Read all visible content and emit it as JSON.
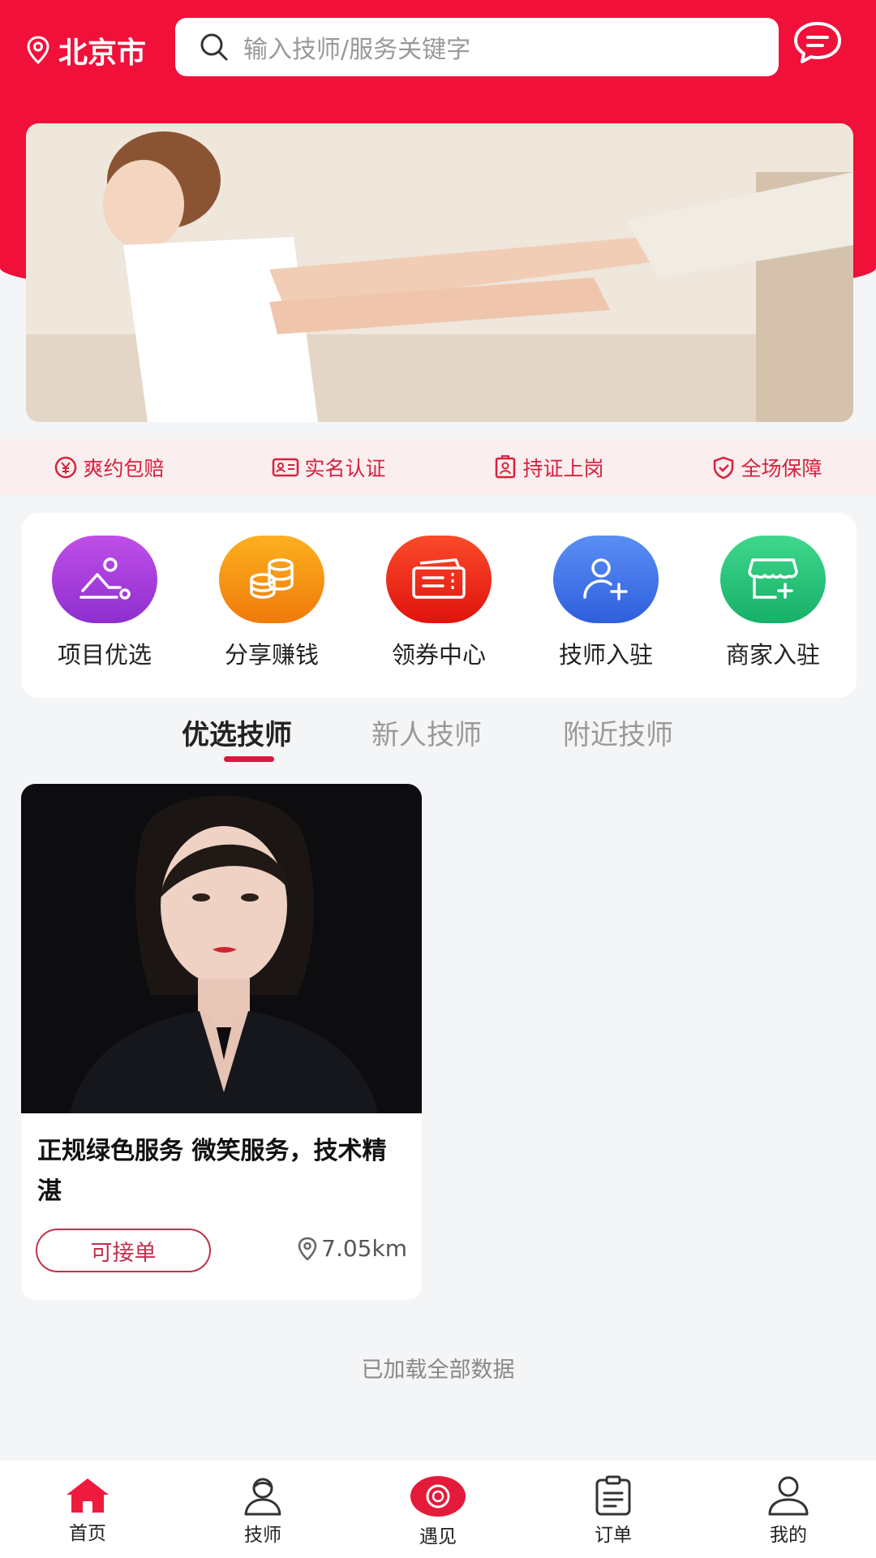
{
  "header": {
    "city": "北京市",
    "search_placeholder": "输入技师/服务关键字",
    "accent_color": "#f0103a"
  },
  "guarantees": [
    {
      "icon": "yen-compensation-icon",
      "label": "爽约包赔"
    },
    {
      "icon": "id-card-icon",
      "label": "实名认证"
    },
    {
      "icon": "certificate-icon",
      "label": "持证上岗"
    },
    {
      "icon": "shield-check-icon",
      "label": "全场保障"
    }
  ],
  "menu": [
    {
      "icon": "massage-icon",
      "label": "项目优选",
      "color": "#a23fd6"
    },
    {
      "icon": "coins-icon",
      "label": "分享赚钱",
      "color": "#f5930c"
    },
    {
      "icon": "coupon-icon",
      "label": "领券中心",
      "color": "#f02a16"
    },
    {
      "icon": "user-plus-icon",
      "label": "技师入驻",
      "color": "#3e73e8"
    },
    {
      "icon": "shop-plus-icon",
      "label": "商家入驻",
      "color": "#22c276"
    }
  ],
  "tabs": [
    "优选技师",
    "新人技师",
    "附近技师"
  ],
  "active_tab": 0,
  "technicians": [
    {
      "description": "正规绿色服务 微笑服务，技术精湛",
      "status": "可接单",
      "distance": "7.05km"
    }
  ],
  "footer_text": "已加载全部数据",
  "tabbar": [
    {
      "icon": "home-icon",
      "label": "首页"
    },
    {
      "icon": "technician-icon",
      "label": "技师"
    },
    {
      "icon": "meet-icon",
      "label": "遇见"
    },
    {
      "icon": "order-icon",
      "label": "订单"
    },
    {
      "icon": "profile-icon",
      "label": "我的"
    }
  ]
}
